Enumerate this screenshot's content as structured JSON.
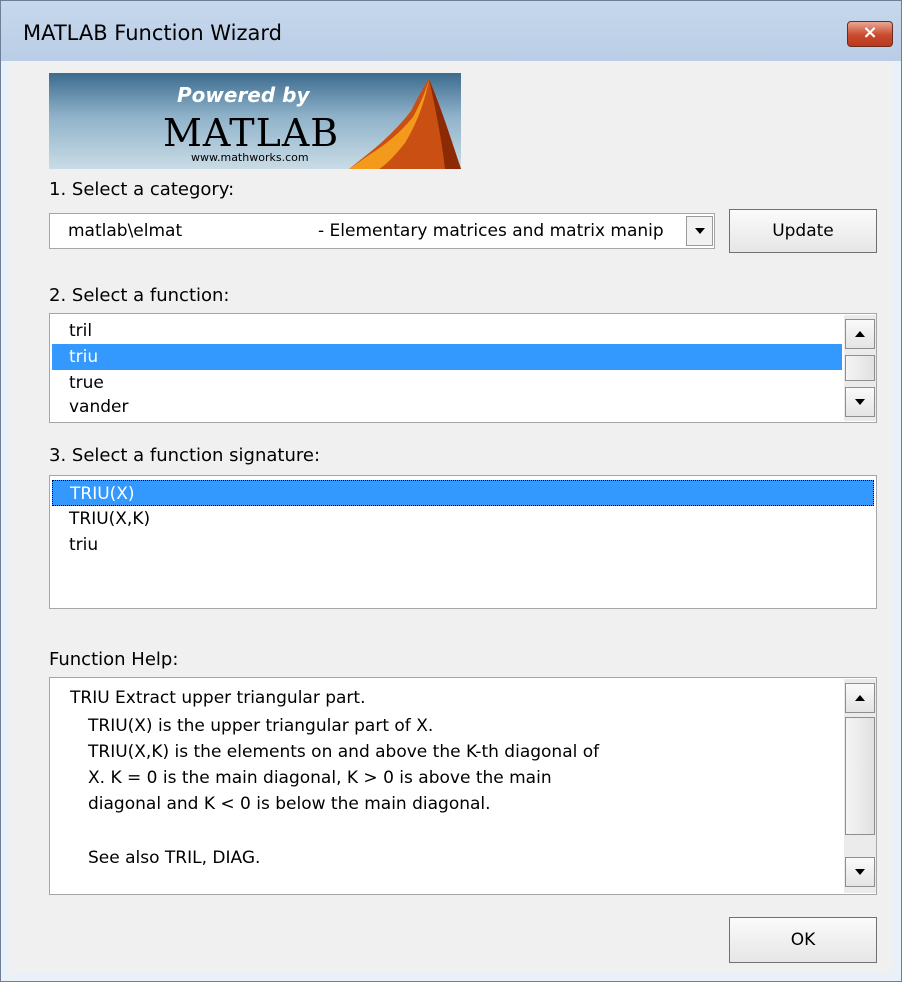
{
  "window": {
    "title": "MATLAB Function Wizard",
    "close_label": "×"
  },
  "logo": {
    "powered": "Powered by",
    "name": "MATLAB",
    "url": "www.mathworks.com"
  },
  "category": {
    "label": "1. Select a category:",
    "selected_name": "matlab\\elmat",
    "selected_desc": "- Elementary matrices and matrix manip",
    "update_label": "Update"
  },
  "functions": {
    "label": "2. Select a function:",
    "items": [
      "tril",
      "triu",
      "true",
      "vander"
    ],
    "selected": "triu"
  },
  "signatures": {
    "label": "3. Select a function signature:",
    "items": [
      "TRIU(X)",
      "TRIU(X,K)",
      "triu"
    ],
    "selected": "TRIU(X)"
  },
  "help": {
    "label": "Function Help:",
    "lines": [
      "TRIU Extract upper triangular part.",
      "TRIU(X) is the upper triangular part of X.",
      "TRIU(X,K) is the elements on and above the K-th diagonal of",
      "X.  K = 0 is the main diagonal, K > 0 is above the main",
      "diagonal and K < 0 is below the main diagonal.",
      "",
      "See also TRIL, DIAG."
    ]
  },
  "ok_label": "OK",
  "colors": {
    "selection": "#3399ff",
    "titlebar": "#b9cde6",
    "close_button": "#c94a2d"
  }
}
